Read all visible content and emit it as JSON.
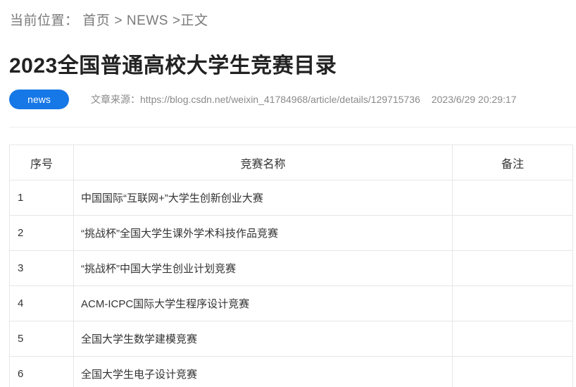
{
  "breadcrumb": {
    "label": "当前位置：",
    "home": "首页",
    "sep1": ">",
    "section": "NEWS",
    "sep2": ">",
    "current": "正文"
  },
  "article": {
    "title": "2023全国普通高校大学生竞赛目录",
    "tag": "news",
    "source": "文章来源：https://blog.csdn.net/weixin_41784968/article/details/129715736",
    "date": "2023/6/29 20:29:17"
  },
  "colors": {
    "accent": "#1677e6",
    "muted": "#8a8a8a",
    "border": "#e6e6e6"
  },
  "table": {
    "headers": [
      "序号",
      "竞赛名称",
      "备注"
    ],
    "rows": [
      {
        "no": "1",
        "name": "中国国际“互联网+”大学生创新创业大赛",
        "note": ""
      },
      {
        "no": "2",
        "name": "“挑战杯”全国大学生课外学术科技作品竞赛",
        "note": ""
      },
      {
        "no": "3",
        "name": "“挑战杯”中国大学生创业计划竞赛",
        "note": ""
      },
      {
        "no": "4",
        "name": "ACM-ICPC国际大学生程序设计竞赛",
        "note": ""
      },
      {
        "no": "5",
        "name": "全国大学生数学建模竞赛",
        "note": ""
      },
      {
        "no": "6",
        "name": "全国大学生电子设计竞赛",
        "note": ""
      }
    ]
  }
}
